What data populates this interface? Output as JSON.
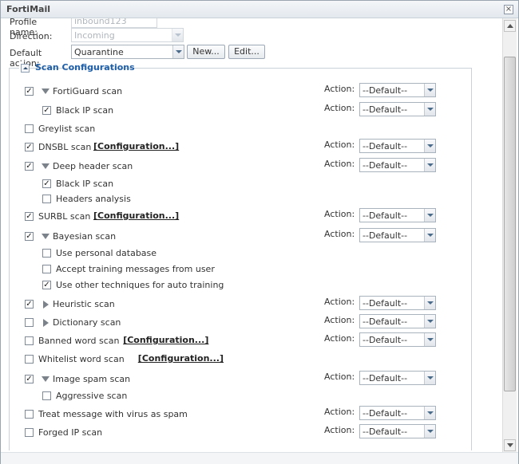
{
  "window": {
    "title": "FortiMail"
  },
  "form": {
    "profile_name_label": "Profile name:",
    "profile_name_value": "inbound123",
    "direction_label": "Direction:",
    "direction_value": "Incoming",
    "default_action_label": "Default action:",
    "default_action_value": "Quarantine",
    "new_button": "New...",
    "edit_button": "Edit..."
  },
  "section": {
    "title": "Scan Configurations"
  },
  "action_label": "Action:",
  "action_default": "--Default--",
  "config_link": "[Configuration...]",
  "rows": [
    {
      "label": "FortiGuard scan",
      "checked": true,
      "expander": "open",
      "action": true
    },
    {
      "label": "Black IP scan",
      "checked": true,
      "indent": true,
      "action": true
    },
    {
      "label": "Greylist scan",
      "checked": false
    },
    {
      "label": "DNSBL scan",
      "checked": true,
      "config": true,
      "action": true
    },
    {
      "label": "Deep header scan",
      "checked": true,
      "expander": "open",
      "action": true
    },
    {
      "label": "Black IP scan",
      "checked": true,
      "indent": true
    },
    {
      "label": "Headers analysis",
      "checked": false,
      "indent": true
    },
    {
      "label": "SURBL scan",
      "checked": true,
      "config": true,
      "action": true
    },
    {
      "label": "Bayesian scan",
      "checked": true,
      "expander": "open",
      "action": true
    },
    {
      "label": "Use personal database",
      "checked": false,
      "indent": true
    },
    {
      "label": "Accept training messages from user",
      "checked": false,
      "indent": true
    },
    {
      "label": "Use other techniques for auto training",
      "checked": true,
      "indent": true
    },
    {
      "label": "Heuristic scan",
      "checked": true,
      "expander": "closed",
      "action": true
    },
    {
      "label": "Dictionary scan",
      "checked": false,
      "expander": "closed",
      "action": true
    },
    {
      "label": "Banned word scan",
      "checked": false,
      "config": true,
      "action": true
    },
    {
      "label": "Whitelist word scan",
      "checked": false,
      "config": true
    },
    {
      "label": "Image spam scan",
      "checked": true,
      "expander": "open",
      "action": true
    },
    {
      "label": "Aggressive scan",
      "checked": false,
      "indent": true
    },
    {
      "label": "Treat message with virus as spam",
      "checked": false,
      "action": true
    },
    {
      "label": "Forged IP scan",
      "checked": false,
      "action": true
    }
  ],
  "colors": {
    "accent": "#1f5fa8",
    "border": "#c9d1d9"
  }
}
